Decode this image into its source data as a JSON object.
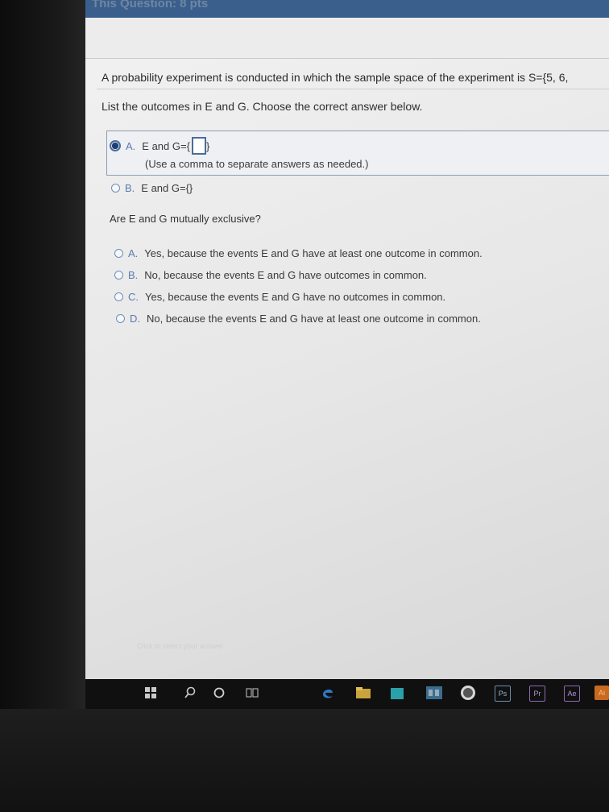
{
  "header": {
    "title": "This Question: 8 pts"
  },
  "question": {
    "text": "A probability experiment is conducted in which the sample space of the experiment is S={5, 6,",
    "prompt": "List the outcomes in E and G. Choose the correct answer below."
  },
  "part1": {
    "options": [
      {
        "letter": "A.",
        "text": "E and G={",
        "closing": "}",
        "selected": true,
        "hint": "(Use a comma to separate answers as needed.)"
      },
      {
        "letter": "B.",
        "text": "E and G={}",
        "selected": false
      }
    ]
  },
  "part2": {
    "question": "Are E and G mutually exclusive?",
    "options": [
      {
        "letter": "A.",
        "text": "Yes, because the events E and G have at least one outcome in common."
      },
      {
        "letter": "B.",
        "text": "No, because the events E and G have outcomes in common."
      },
      {
        "letter": "C.",
        "text": "Yes, because the events E and G have no outcomes in common."
      },
      {
        "letter": "D.",
        "text": "No, because the events E and G have at least one outcome in common."
      }
    ]
  },
  "footer": {
    "hint": "Click to select your answer"
  },
  "taskbar": {
    "icons": [
      "windows-icon",
      "search-icon",
      "cortana-icon",
      "task-view-icon",
      "edge-icon",
      "file-explorer-icon",
      "store-icon",
      "vm-icon",
      "hp-icon",
      "photoshop-icon",
      "premiere-icon",
      "after-effects-icon",
      "illustrator-icon"
    ],
    "labels": {
      "ps": "Ps",
      "pr": "Pr",
      "ae": "Ae",
      "ai": "Ai"
    }
  },
  "colors": {
    "accent": "#4b6d99",
    "header": "#3a5f8c",
    "letter": "#5b7ab0"
  }
}
